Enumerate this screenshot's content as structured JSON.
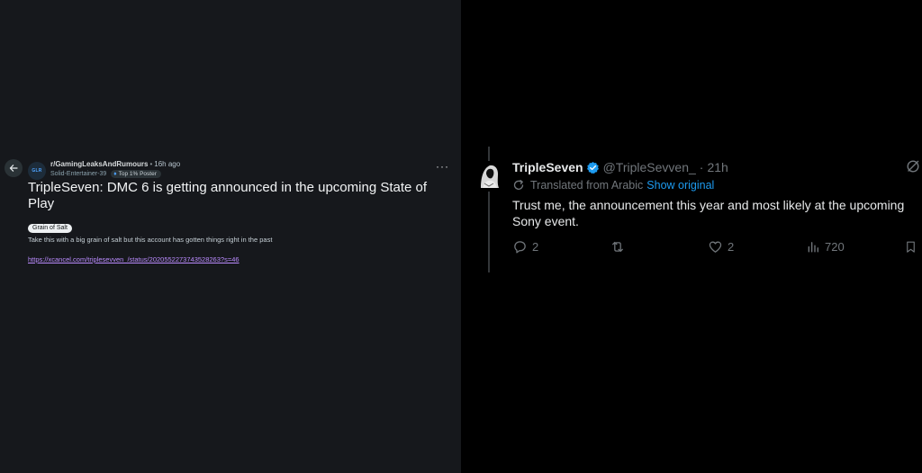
{
  "reddit": {
    "subreddit": "r/GamingLeaksAndRumours",
    "subreddit_icon_text": "GLR",
    "age": "16h ago",
    "author": "Solid-Entertainer-39",
    "author_badge": "Top 1% Poster",
    "title": "TripleSeven: DMC 6 is getting announced in the upcoming State of Play",
    "flair": "Grain of Salt",
    "body": "Take this with a big grain of salt but this account has gotten things right in the past",
    "link": "https://xcancel.com/triplesevven_/status/2020552273743528263?s=46"
  },
  "tweet": {
    "display_name": "TripleSeven",
    "handle": "@TripleSevven_",
    "separator": "·",
    "time": "21h",
    "translated_label": "Translated from Arabic",
    "show_original": "Show original",
    "text": "Trust me, the announcement this year and most likely at the upcoming Sony event.",
    "replies": "2",
    "reposts": "",
    "likes": "2",
    "views": "720"
  },
  "colors": {
    "reddit_bg": "#16181c",
    "x_bg": "#000000",
    "link_purple": "#bb8cff",
    "x_blue": "#1d9bf0",
    "x_gray": "#71767b"
  },
  "icons": {
    "back": "arrow-left-icon",
    "more": "more-horizontal-icon",
    "verified": "verified-badge-icon",
    "grok": "grok-icon",
    "translate": "translate-icon",
    "reply": "reply-icon",
    "repost": "repost-icon",
    "like": "heart-icon",
    "views": "views-chart-icon",
    "bookmark": "bookmark-icon"
  }
}
